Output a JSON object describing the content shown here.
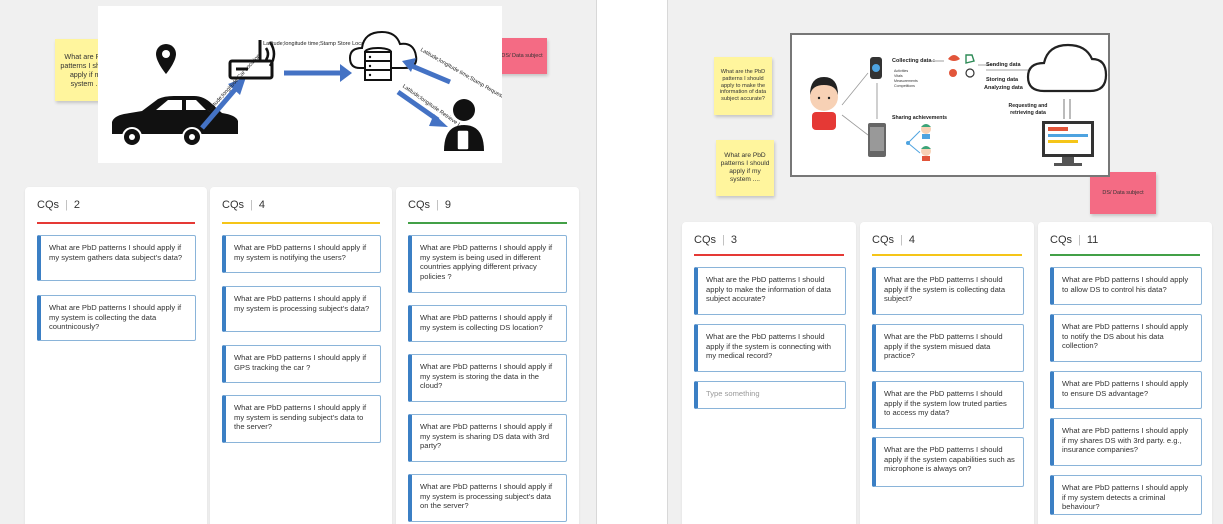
{
  "colors": {
    "red": "#e53935",
    "yellow": "#f5c518",
    "green": "#43a047",
    "card_accent": "#3b7fc4",
    "sticky_yellow": "#fff59d",
    "sticky_pink": "#f46b84"
  },
  "left": {
    "sticky": "What are PbD patterns I should apply if my system ....",
    "ds_note": "DS/ Data subject",
    "diagram": {
      "car_to_router": "Latitude;longitude Car Location",
      "router_to_cloud": "Latitude;longitude time;Stamp Store Location",
      "user_to_cloud": "Latitude;longitude time;Stamp Request Location",
      "cloud_to_user": "Latitude;longitude Retrieve Location"
    },
    "columns": [
      {
        "title": "CQs",
        "count": "2",
        "cards": [
          "What are PbD patterns I should apply if my system gathers data subject's data?",
          "What are PbD patterns I should apply if my system is collecting the data countnicously?"
        ]
      },
      {
        "title": "CQs",
        "count": "4",
        "cards": [
          "What are PbD patterns I should apply if my system is notifying the users?",
          "What are PbD patterns I should apply if my system is processing subject's data?",
          "What are PbD patterns I should apply if GPS tracking the car ?",
          "What are PbD patterns I should apply if my system is sending subject's data to the server?"
        ]
      },
      {
        "title": "CQs",
        "count": "9",
        "cards": [
          "What are PbD patterns I should apply if my system is being used in different countries applying different privacy policies ?",
          "What are PbD patterns I should apply if my system is collecting DS location?",
          "What are PbD patterns I should apply if my system is storing the data in the cloud?",
          "What are PbD patterns I should apply if my system is sharing DS data with 3rd party?",
          "What are PbD patterns I should apply if my system is processing subject's data on the server?"
        ]
      }
    ]
  },
  "right": {
    "sticky1": "What are the PbD patterns I should apply to make the information of data subject accurate?",
    "sticky2": "What are PbD patterns I should apply if my system ....",
    "ds_note": "DS/ Data subject",
    "diagram": {
      "collecting_title": "Collecting data :",
      "collecting_items": [
        "Activities",
        "Vitals",
        "Measurements",
        "Competitions"
      ],
      "sending": "Sending data",
      "storing": "Storing data",
      "analyzing": "Analyzing data",
      "requesting": "Requesting and",
      "retrieving": "retrieving data",
      "sharing": "Sharing achievements"
    },
    "columns": [
      {
        "title": "CQs",
        "count": "3",
        "cards": [
          "What are the PbD patterns I should apply to make the information of data subject accurate?",
          "What are the PbD patterns I should apply if the system is connecting with my medical record?"
        ],
        "placeholder": "Type something"
      },
      {
        "title": "CQs",
        "count": "4",
        "cards": [
          "What are the PbD patterns I should apply if the system is collecting data subject?",
          "What are the PbD patterns I should apply if the system misued data practice?",
          "What are the PbD patterns I should apply if the system low truted parties to access my data?",
          "What are the PbD patterns I should apply if the system capabilities such as microphone is always on?"
        ]
      },
      {
        "title": "CQs",
        "count": "11",
        "cards": [
          "What are PbD patterns I should apply to allow DS to control his data?",
          "What are PbD patterns I should apply to notify the DS about his data collection?",
          "What are PbD patterns I should apply to ensure DS advantage?",
          "What are PbD patterns I should apply if my shares DS with 3rd party. e.g., insurance companies?",
          "What are PbD patterns I should apply if my system detects a criminal behaviour?"
        ]
      }
    ]
  }
}
